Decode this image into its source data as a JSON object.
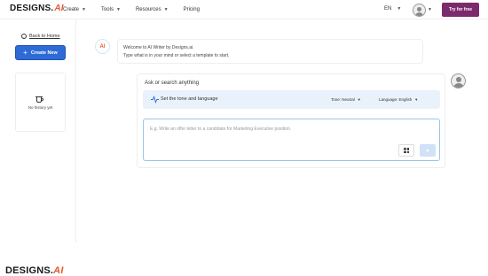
{
  "header": {
    "logo_text": "DESIGNS.",
    "logo_ai": "AI",
    "nav": [
      {
        "label": "Create"
      },
      {
        "label": "Tools"
      },
      {
        "label": "Resources"
      },
      {
        "label": "Pricing"
      }
    ],
    "language": "EN",
    "try_button": "Try for free"
  },
  "sidebar": {
    "back_label": "Back to Home",
    "create_button": "Create New",
    "history_empty": "No history yet"
  },
  "chat": {
    "bot_avatar_text": "AI",
    "welcome_line1": "Welcome to AI Writer by Designs.ai.",
    "welcome_line2": "Type what is in your mind or select a template to start."
  },
  "composer": {
    "title": "Ask or search anything",
    "tone_label": "Set the tone and language",
    "tone_select": "Tone: Neutral",
    "language_select": "Language: English",
    "input_placeholder": "E.g. Write an offer letter to a candidate for Marketing Executive position."
  },
  "footer": {
    "logo_text": "DESIGNS.",
    "logo_ai": "AI"
  },
  "colors": {
    "accent": "#2e6bd6",
    "brand": "#7b2a6b",
    "logo_accent": "#e4572e",
    "tone_bar": "#e9f1fb"
  }
}
